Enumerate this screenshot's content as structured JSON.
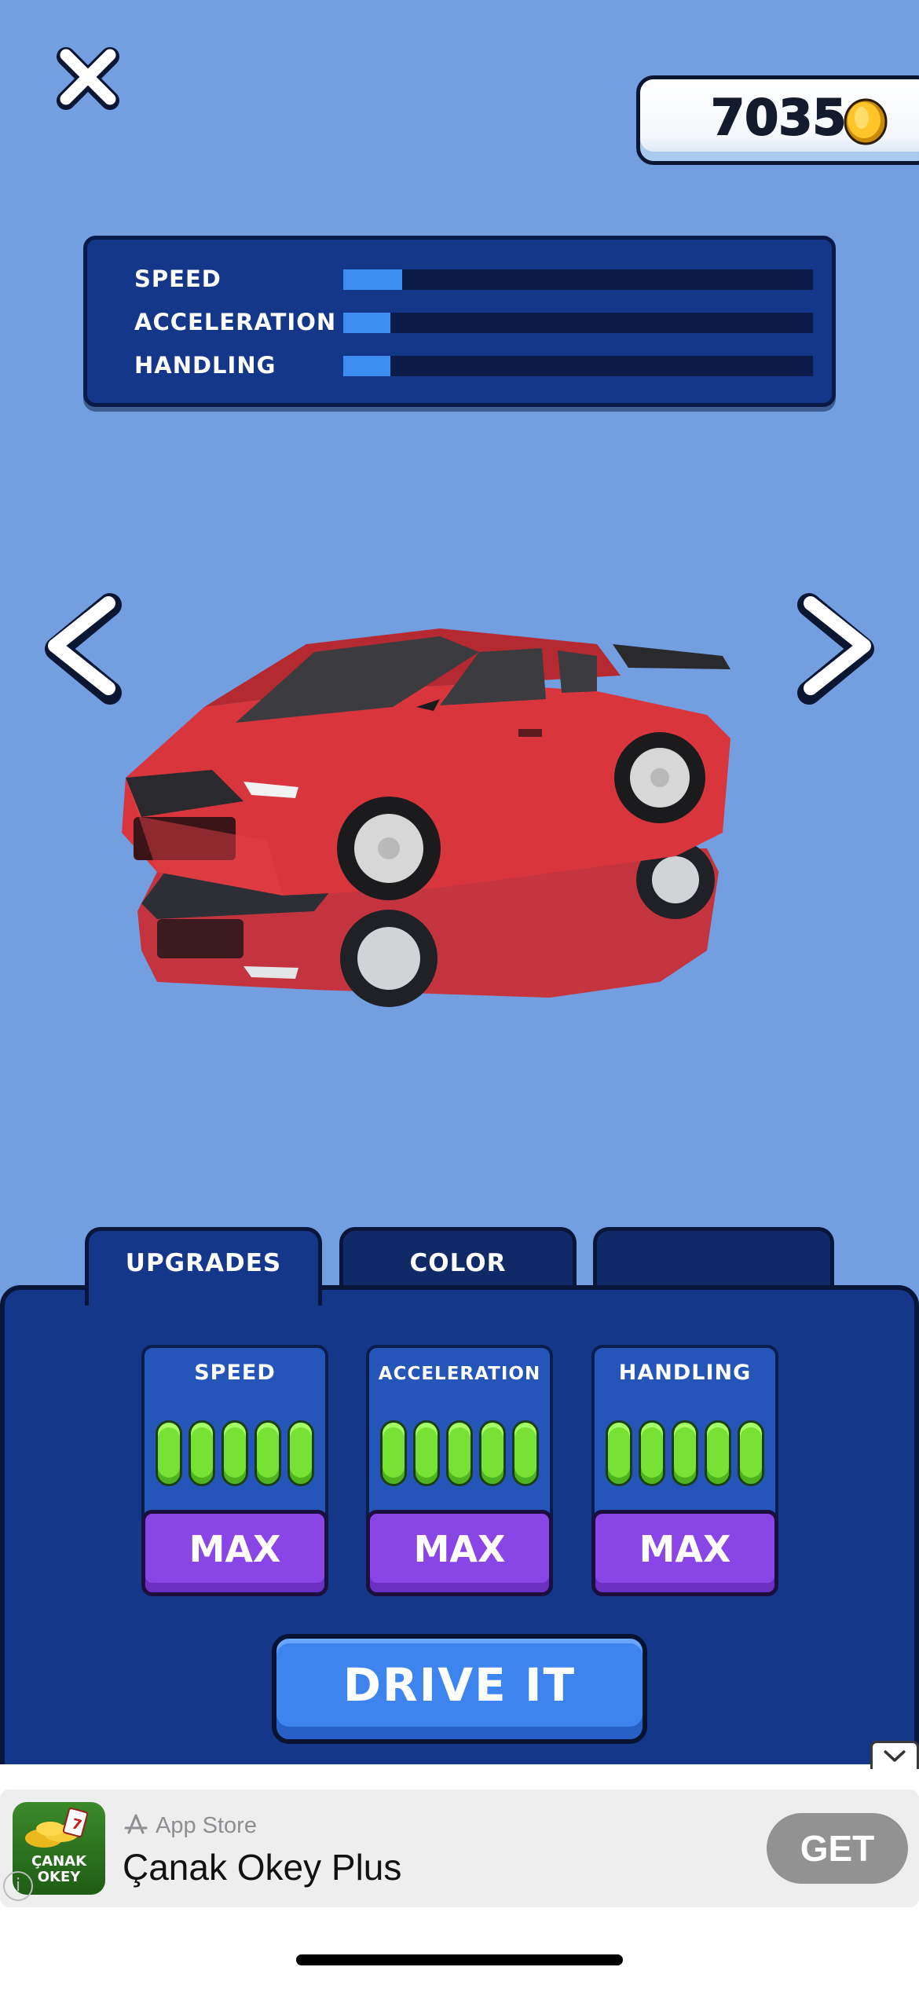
{
  "header": {
    "coins": "7035",
    "close_icon": "close-x-icon",
    "coin_icon": "gold-coin-icon"
  },
  "stats": [
    {
      "label": "SPEED",
      "level": 0.125
    },
    {
      "label": "ACCELERATION",
      "level": 0.1
    },
    {
      "label": "HANDLING",
      "level": 0.1
    }
  ],
  "carousel": {
    "prev_icon": "chevron-left-icon",
    "next_icon": "chevron-right-icon",
    "car_color": "#d8363c"
  },
  "tabs": [
    {
      "label": "UPGRADES",
      "active": true
    },
    {
      "label": "COLOR",
      "active": false
    },
    {
      "label": "",
      "active": false
    }
  ],
  "upgrades": [
    {
      "title": "SPEED",
      "filled": 5,
      "total": 5,
      "button": "MAX"
    },
    {
      "title": "ACCELERATION",
      "filled": 5,
      "total": 5,
      "button": "MAX"
    },
    {
      "title": "HANDLING",
      "filled": 5,
      "total": 5,
      "button": "MAX"
    }
  ],
  "drive_button": "DRIVE IT",
  "ad": {
    "store_label": "App Store",
    "title": "Çanak Okey Plus",
    "get_label": "GET",
    "icon_text": "ÇANAK OKEY",
    "info_glyph": "i"
  },
  "colors": {
    "background": "#739fe0",
    "panel": "#14378a",
    "stat_fill": "#3d8ef0",
    "pip_green": "#77e234",
    "max_purple": "#8a45e6",
    "drive_blue": "#3d84ee"
  }
}
